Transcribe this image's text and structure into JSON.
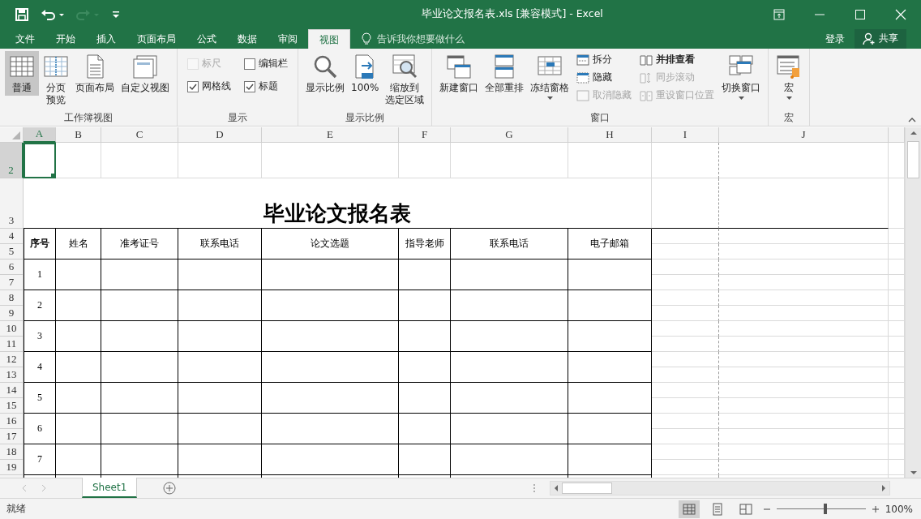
{
  "window": {
    "title": "毕业论文报名表.xls  [兼容模式] - Excel"
  },
  "quick_access": {
    "redo_disabled": true
  },
  "ribbon_tabs": [
    {
      "label": "文件",
      "selected": false
    },
    {
      "label": "开始",
      "selected": false
    },
    {
      "label": "插入",
      "selected": false
    },
    {
      "label": "页面布局",
      "selected": false
    },
    {
      "label": "公式",
      "selected": false
    },
    {
      "label": "数据",
      "selected": false
    },
    {
      "label": "审阅",
      "selected": false
    },
    {
      "label": "视图",
      "selected": true
    }
  ],
  "tell_me": {
    "placeholder": "告诉我你想要做什么"
  },
  "account": {
    "sign_in": "登录",
    "share": "共享"
  },
  "ribbon_groups": [
    {
      "title": "工作簿视图",
      "columns": [
        [
          {
            "kind": "large",
            "lines": [
              "普通"
            ],
            "selected": true
          }
        ],
        [
          {
            "kind": "large",
            "lines": [
              "分页",
              "预览"
            ],
            "selected": false
          }
        ],
        [
          {
            "kind": "large",
            "lines": [
              "页面布局"
            ],
            "selected": false
          }
        ],
        [
          {
            "kind": "large",
            "lines": [
              "自定义视图"
            ],
            "selected": false
          }
        ]
      ]
    },
    {
      "title": "显示",
      "columns": [
        [
          {
            "kind": "checkbox",
            "label": "标尺",
            "checked": false,
            "disabled": true
          },
          {
            "kind": "checkbox",
            "label": "网格线",
            "checked": true,
            "disabled": false
          }
        ],
        [
          {
            "kind": "checkbox",
            "label": "编辑栏",
            "checked": false,
            "disabled": false
          },
          {
            "kind": "checkbox",
            "label": "标题",
            "checked": true,
            "disabled": false
          }
        ]
      ]
    },
    {
      "title": "显示比例",
      "columns": [
        [
          {
            "kind": "large",
            "lines": [
              "显示比例"
            ],
            "selected": false
          }
        ],
        [
          {
            "kind": "large",
            "lines": [
              "100%"
            ],
            "selected": false
          }
        ],
        [
          {
            "kind": "large",
            "lines": [
              "缩放到",
              "选定区域"
            ],
            "selected": false
          }
        ]
      ]
    },
    {
      "title": "窗口",
      "columns": [
        [
          {
            "kind": "large",
            "lines": [
              "新建窗口"
            ],
            "selected": false
          }
        ],
        [
          {
            "kind": "large",
            "lines": [
              "全部重排"
            ],
            "selected": false
          }
        ],
        [
          {
            "kind": "large",
            "lines": [
              "冻结窗格"
            ],
            "selected": false,
            "dropdown": true
          }
        ],
        [
          {
            "kind": "small",
            "label": "拆分",
            "disabled": false
          },
          {
            "kind": "small",
            "label": "隐藏",
            "disabled": false
          },
          {
            "kind": "small",
            "label": "取消隐藏",
            "disabled": true
          }
        ],
        [
          {
            "kind": "small",
            "label": "并排查看",
            "disabled": false
          },
          {
            "kind": "small",
            "label": "同步滚动",
            "disabled": true
          },
          {
            "kind": "small",
            "label": "重设窗口位置",
            "disabled": true
          }
        ],
        [
          {
            "kind": "large",
            "lines": [
              "切换窗口"
            ],
            "selected": false,
            "dropdown": true
          }
        ]
      ]
    },
    {
      "title": "宏",
      "columns": [
        [
          {
            "kind": "large",
            "lines": [
              "宏"
            ],
            "selected": false,
            "dropdown": true
          }
        ]
      ]
    }
  ],
  "sheet": {
    "columns": [
      {
        "label": "A",
        "selected": true
      },
      {
        "label": "B",
        "selected": false
      },
      {
        "label": "C",
        "selected": false
      },
      {
        "label": "D",
        "selected": false
      },
      {
        "label": "E",
        "selected": false
      },
      {
        "label": "F",
        "selected": false
      },
      {
        "label": "G",
        "selected": false
      },
      {
        "label": "H",
        "selected": false
      },
      {
        "label": "I",
        "selected": false
      },
      {
        "label": "J",
        "selected": false
      }
    ],
    "rows": [
      {
        "label": "2",
        "selected": true
      },
      {
        "label": "3",
        "selected": false
      },
      {
        "label": "4",
        "selected": false
      },
      {
        "label": "5",
        "selected": false
      },
      {
        "label": "6",
        "selected": false
      },
      {
        "label": "7",
        "selected": false
      },
      {
        "label": "8",
        "selected": false
      },
      {
        "label": "9",
        "selected": false
      },
      {
        "label": "10",
        "selected": false
      },
      {
        "label": "11",
        "selected": false
      },
      {
        "label": "12",
        "selected": false
      },
      {
        "label": "13",
        "selected": false
      },
      {
        "label": "14",
        "selected": false
      },
      {
        "label": "15",
        "selected": false
      },
      {
        "label": "16",
        "selected": false
      },
      {
        "label": "17",
        "selected": false
      },
      {
        "label": "18",
        "selected": false
      },
      {
        "label": "19",
        "selected": false
      }
    ],
    "form_title": "毕业论文报名表",
    "headers": [
      "序号",
      "姓名",
      "准考证号",
      "联系电话",
      "论文选题",
      "指导老师",
      "联系电话",
      "电子邮箱"
    ],
    "entries": [
      "1",
      "2",
      "3",
      "4",
      "5",
      "6",
      "7"
    ]
  },
  "sheet_tabs": [
    {
      "label": "Sheet1",
      "selected": true
    }
  ],
  "status_bar": {
    "status": "就绪",
    "views": [
      {
        "selected": true
      },
      {
        "selected": false
      },
      {
        "selected": false
      }
    ],
    "zoom": {
      "level": 0.55,
      "reading": "100%"
    }
  }
}
